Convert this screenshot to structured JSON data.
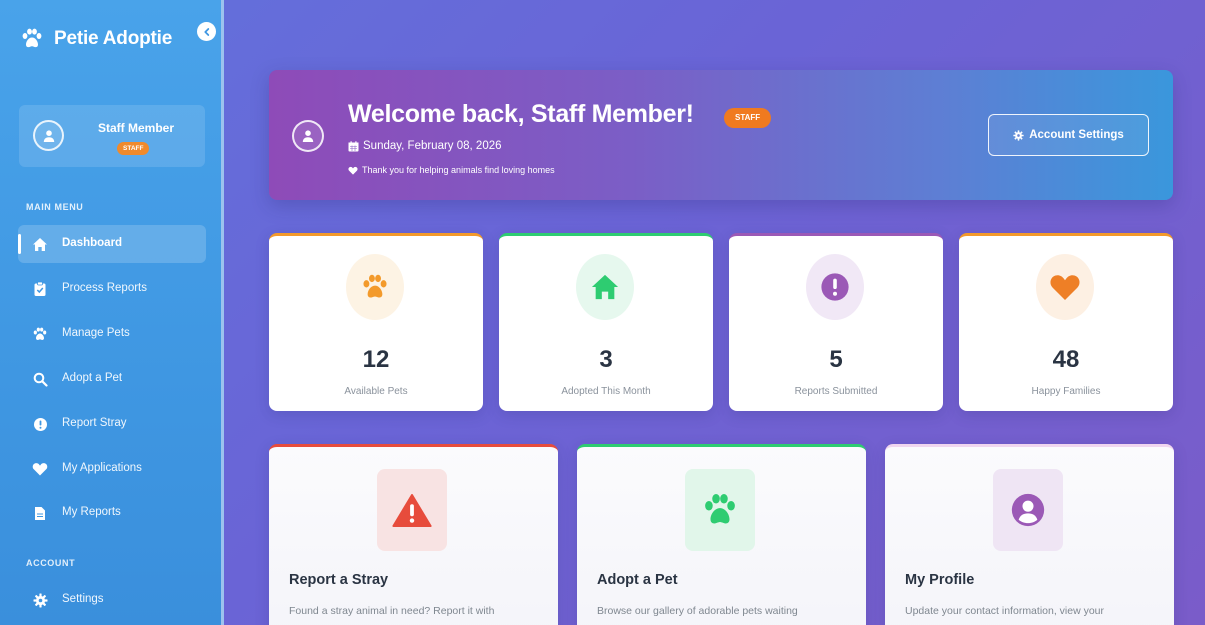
{
  "sidebar": {
    "brand": "Petie Adoptie",
    "user": {
      "name": "Staff Member",
      "role": "STAFF"
    },
    "main_menu_label": "MAIN MENU",
    "items": [
      {
        "label": "Dashboard",
        "icon": "home-icon",
        "active": true
      },
      {
        "label": "Process Reports",
        "icon": "clipboard-check-icon"
      },
      {
        "label": "Manage Pets",
        "icon": "paw-icon"
      },
      {
        "label": "Adopt a Pet",
        "icon": "search-icon"
      },
      {
        "label": "Report Stray",
        "icon": "exclamation-circle-icon"
      },
      {
        "label": "My Applications",
        "icon": "heart-icon"
      },
      {
        "label": "My Reports",
        "icon": "file-icon"
      }
    ],
    "account_label": "ACCOUNT",
    "account_items": [
      {
        "label": "Settings",
        "icon": "gear-icon"
      }
    ]
  },
  "welcome": {
    "title": "Welcome back, Staff Member!",
    "badge": "STAFF",
    "date": "Sunday, February 08, 2026",
    "thanks": "Thank you for helping animals find loving homes",
    "account_button": "Account Settings"
  },
  "stats": [
    {
      "value": "12",
      "label": "Available Pets",
      "icon": "paw-icon",
      "color": "#f39a2b"
    },
    {
      "value": "3",
      "label": "Adopted This Month",
      "icon": "home-icon",
      "color": "#2ecc71"
    },
    {
      "value": "5",
      "label": "Reports Submitted",
      "icon": "exclamation-circle-icon",
      "color": "#9b59b6"
    },
    {
      "value": "48",
      "label": "Happy Families",
      "icon": "heart-icon",
      "color": "#f39a2b"
    }
  ],
  "actions": [
    {
      "title": "Report a Stray",
      "desc": "Found a stray animal in need? Report it with",
      "icon": "warning-triangle-icon",
      "color": "#e74c3c"
    },
    {
      "title": "Adopt a Pet",
      "desc": "Browse our gallery of adorable pets waiting",
      "icon": "paw-icon",
      "color": "#2ecc71"
    },
    {
      "title": "My Profile",
      "desc": "Update your contact information, view your",
      "icon": "user-circle-icon",
      "color": "#9b59b6"
    }
  ],
  "colors": {
    "sidebar": "#4299e4",
    "background": "#6a68d8",
    "staff_badge": "#f07a1f"
  }
}
